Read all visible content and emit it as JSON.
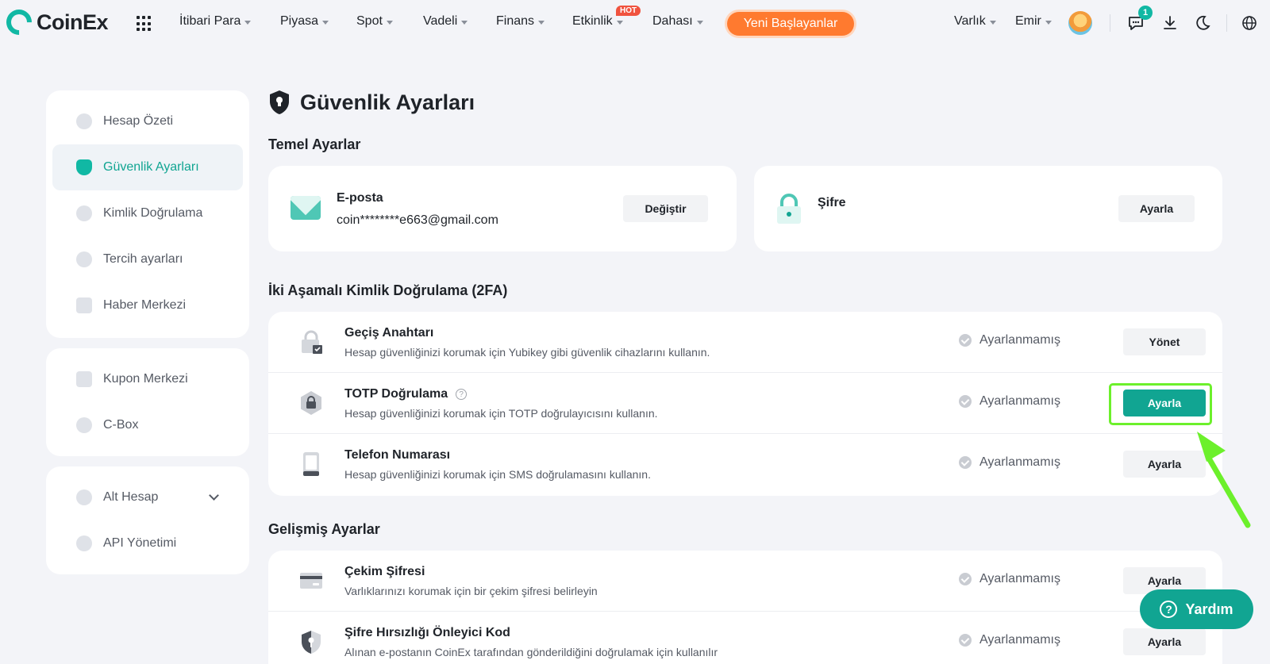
{
  "brand": {
    "name": "CoinEx",
    "accent": "#11b8a4",
    "highlight": "#6cf02b",
    "cta": "#ff7a2f"
  },
  "nav": {
    "items": [
      "İtibari Para",
      "Piyasa",
      "Spot",
      "Vadeli",
      "Finans",
      "Etkinlik",
      "Dahası"
    ],
    "hot_badge": "HOT",
    "beginner_button": "Yeni Başlayanlar",
    "right_items": [
      "Varlık",
      "Emir"
    ],
    "message_count": "1"
  },
  "sidebar": {
    "group1": [
      "Hesap Özeti",
      "Güvenlik Ayarları",
      "Kimlik Doğrulama",
      "Tercih ayarları",
      "Haber Merkezi"
    ],
    "group2": [
      "Kupon Merkezi",
      "C-Box"
    ],
    "group3": [
      "Alt Hesap",
      "API Yönetimi"
    ],
    "active": "Güvenlik Ayarları"
  },
  "page": {
    "title": "Güvenlik Ayarları",
    "basic_section": "Temel Ayarlar",
    "email_label": "E-posta",
    "email_value": "coin********e663@gmail.com",
    "email_button": "Değiştir",
    "password_label": "Şifre",
    "password_button": "Ayarla",
    "twofa_section": "İki Aşamalı Kimlik Doğrulama (2FA)",
    "advanced_section": "Gelişmiş Ayarlar"
  },
  "twofa_rows": [
    {
      "title": "Geçiş Anahtarı",
      "desc": "Hesap güvenliğinizi korumak için Yubikey gibi güvenlik cihazlarını kullanın.",
      "status": "Ayarlanmamış",
      "button": "Yönet"
    },
    {
      "title": "TOTP Doğrulama",
      "desc": "Hesap güvenliğinizi korumak için TOTP doğrulayıcısını kullanın.",
      "status": "Ayarlanmamış",
      "button": "Ayarla"
    },
    {
      "title": "Telefon Numarası",
      "desc": "Hesap güvenliğinizi korumak için SMS doğrulamasını kullanın.",
      "status": "Ayarlanmamış",
      "button": "Ayarla"
    }
  ],
  "advanced_rows": [
    {
      "title": "Çekim Şifresi",
      "desc": "Varlıklarınızı korumak için bir çekim şifresi belirleyin",
      "status": "Ayarlanmamış",
      "button": "Ayarla"
    },
    {
      "title": "Şifre Hırsızlığı Önleyici Kod",
      "desc": "Alınan e-postanın CoinEx tarafından gönderildiğini doğrulamak için kullanılır",
      "status": "Ayarlanmamış",
      "button": "Ayarla"
    }
  ],
  "help_button": "Yardım",
  "icons": [
    "coinex-logo-icon",
    "apps-grid-icon",
    "avatar",
    "message-icon",
    "download-icon",
    "dark-mode-icon",
    "globe-icon",
    "shield-icon",
    "email-icon",
    "lock-icon",
    "passkey-icon",
    "totp-icon",
    "phone-icon",
    "card-icon",
    "shield-key-icon",
    "check-circle-icon",
    "help-icon"
  ]
}
